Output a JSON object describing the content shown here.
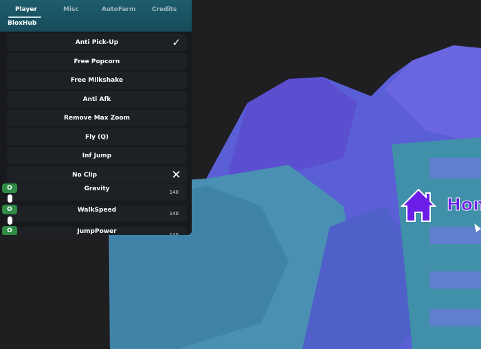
{
  "tabs": [
    {
      "label": "Player",
      "active": true
    },
    {
      "label": "Misc"
    },
    {
      "label": "AutoFarm"
    },
    {
      "label": "Credits"
    }
  ],
  "brand": "BloxHub",
  "toggles": [
    {
      "label": "Anti Pick-Up",
      "state": "check-icon"
    },
    {
      "label": "Free Popcorn"
    },
    {
      "label": "Free Milkshake"
    },
    {
      "label": "Anti Afk"
    },
    {
      "label": "Remove Max Zoom"
    },
    {
      "label": "Fly (Q)"
    },
    {
      "label": "Inf Jump"
    },
    {
      "label": "No Clip",
      "state": "x-icon"
    }
  ],
  "sliders": [
    {
      "label": "Gravity",
      "value": "140",
      "knob": "O"
    },
    {
      "label": "WalkSpeed",
      "value": "140",
      "knob": "O"
    },
    {
      "label": "JumpPower",
      "value": "140",
      "knob": "O"
    }
  ],
  "world": {
    "sign_text": "Hom",
    "sign_color": "#6a1ee8"
  }
}
